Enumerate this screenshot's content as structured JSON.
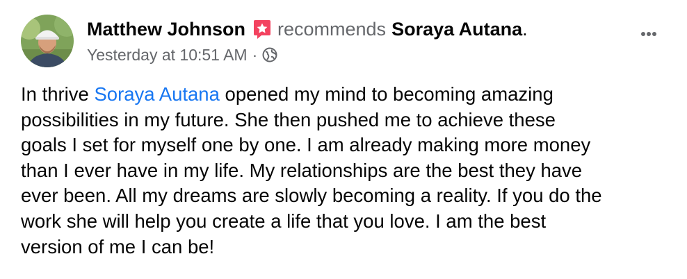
{
  "post": {
    "author": "Matthew Johnson",
    "verb": "recommends",
    "page": "Soraya Autana",
    "period": ".",
    "timestamp": "Yesterday at 10:51 AM",
    "separator": "·",
    "audience_icon": "globe-icon",
    "more_icon": "more-options-icon",
    "badge_icon": "recommendation-star-icon",
    "badge_color": "#f3425f",
    "link_color": "#1877f2",
    "body": {
      "line1_pre": "In thrive ",
      "mention": "Soraya Autana",
      "line1_post": " opened my mind to becoming amazing",
      "line2": "possibilities in my future. She then pushed me to achieve these",
      "line3": "goals I set for myself one by one. I am already making more money",
      "line4": "than I ever have in my life. My relationships are the best they have",
      "line5": "ever been. All my dreams are slowly becoming a reality. If you do the",
      "line6": "work she will help you create a life that you love. I am the best",
      "line7": "version of me I can be!"
    }
  }
}
